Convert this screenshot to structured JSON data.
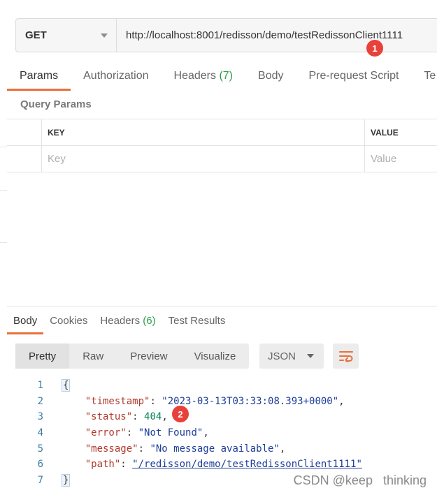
{
  "request": {
    "method": "GET",
    "url": "http://localhost:8001/redisson/demo/testRedissonClient1111"
  },
  "badges": [
    "1",
    "2"
  ],
  "request_tabs": [
    {
      "label": "Params",
      "count": ""
    },
    {
      "label": "Authorization",
      "count": ""
    },
    {
      "label": "Headers",
      "count": "(7)"
    },
    {
      "label": "Body",
      "count": ""
    },
    {
      "label": "Pre-request Script",
      "count": ""
    },
    {
      "label": "Te",
      "count": ""
    }
  ],
  "query_params": {
    "title": "Query Params",
    "columns": [
      "KEY",
      "VALUE"
    ],
    "placeholders": [
      "Key",
      "Value"
    ]
  },
  "response_tabs": [
    {
      "label": "Body",
      "count": ""
    },
    {
      "label": "Cookies",
      "count": ""
    },
    {
      "label": "Headers",
      "count": "(6)"
    },
    {
      "label": "Test Results",
      "count": ""
    }
  ],
  "format_buttons": [
    "Pretty",
    "Raw",
    "Preview",
    "Visualize"
  ],
  "format_select": "JSON",
  "icons": {
    "wrap": "wrap-lines-icon",
    "dropdown": "chevron-down-icon"
  },
  "colors": {
    "accent": "#e8703a",
    "badge": "#e8413a",
    "count": "#2e9e4a"
  },
  "response_body": {
    "line_numbers": [
      "1",
      "2",
      "3",
      "4",
      "5",
      "6",
      "7"
    ],
    "open_brace": "{",
    "close_brace": "}",
    "fields": [
      {
        "key": "\"timestamp\"",
        "value": "\"2023-03-13T03:33:08.393+0000\"",
        "kind": "str"
      },
      {
        "key": "\"status\"",
        "value": "404",
        "kind": "num"
      },
      {
        "key": "\"error\"",
        "value": "\"Not Found\"",
        "kind": "str"
      },
      {
        "key": "\"message\"",
        "value": "\"No message available\"",
        "kind": "str"
      },
      {
        "key": "\"path\"",
        "value": "\"/redisson/demo/testRedissonClient1111\"",
        "kind": "link"
      }
    ]
  },
  "watermark": "CSDN @keep   thinking"
}
